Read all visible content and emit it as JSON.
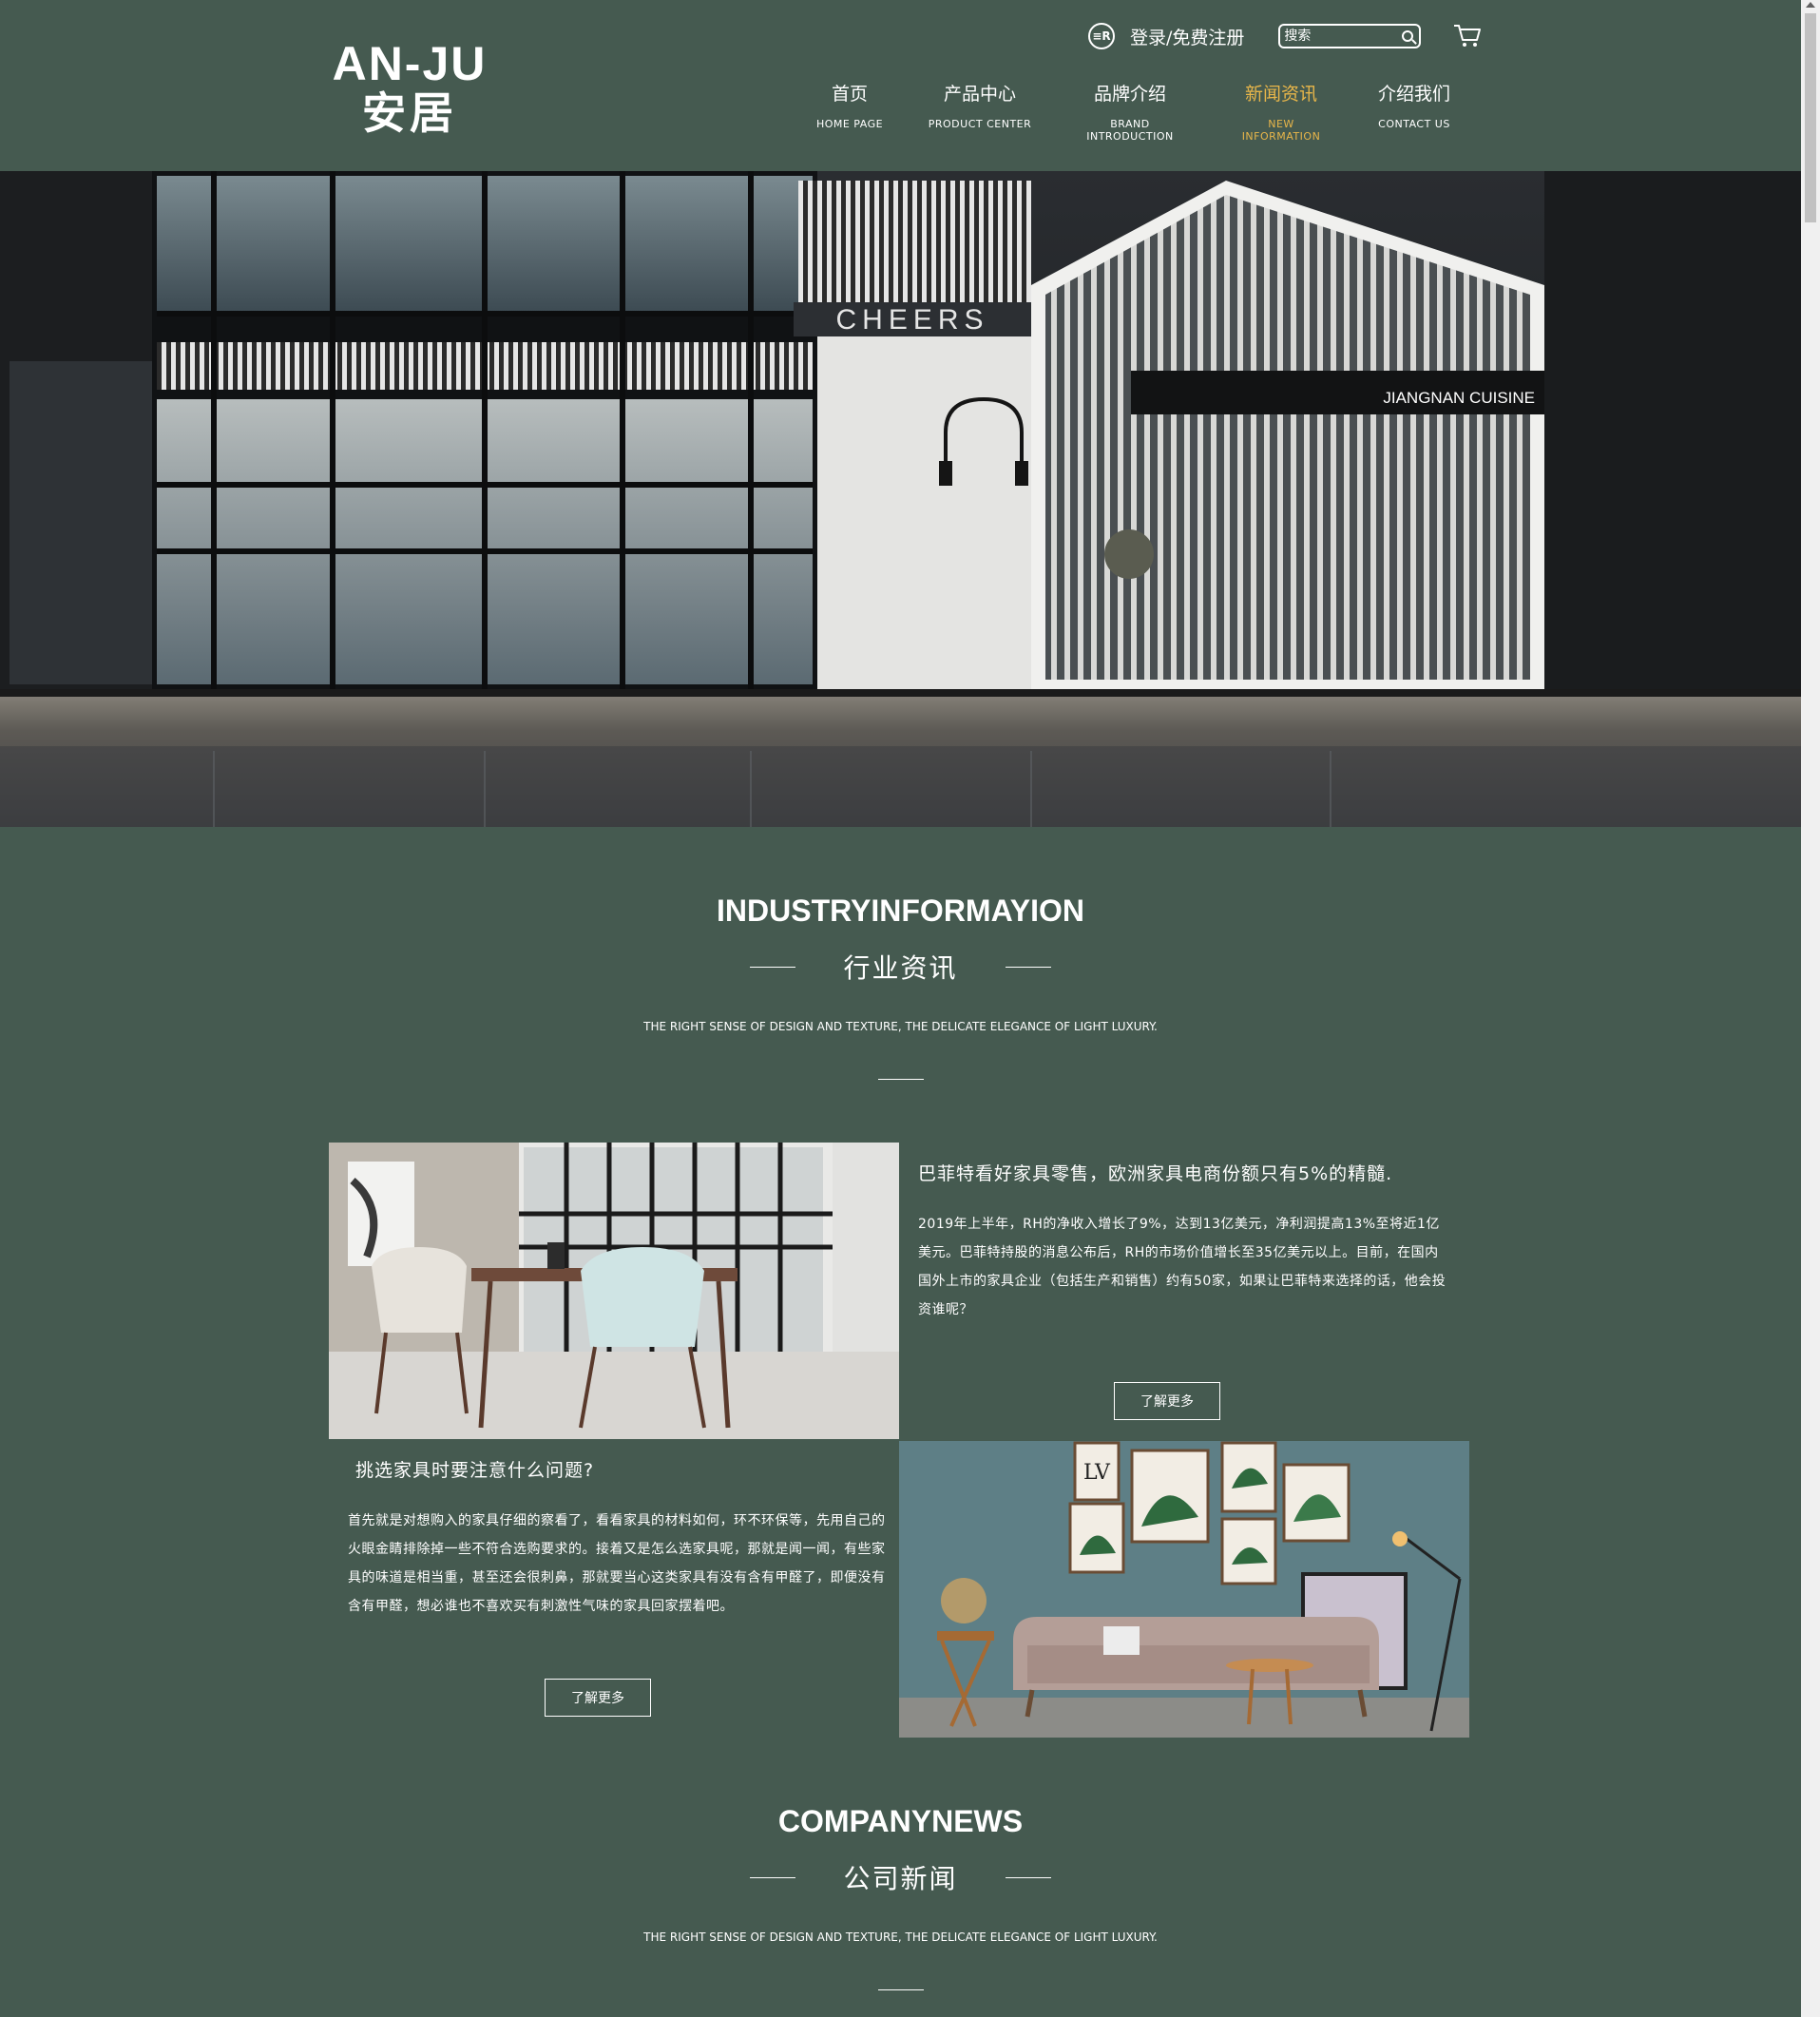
{
  "header": {
    "logo_en": "AN-JU",
    "logo_cn": "安居",
    "login_icon_text": "≡R",
    "login_text": "登录/免费注册",
    "search_placeholder": "搜索",
    "nav": [
      {
        "cn": "首页",
        "en": "HOME   PAGE",
        "active": false
      },
      {
        "cn": "产品中心",
        "en": "PRODUCT   CENTER",
        "active": false
      },
      {
        "cn": "品牌介绍",
        "en": "BRAND   INTRODUCTION",
        "active": false
      },
      {
        "cn": "新闻资讯",
        "en": "NEW   INFORMATION",
        "active": true
      },
      {
        "cn": "介绍我们",
        "en": "CONTACT   US",
        "active": false
      }
    ],
    "active_color": "#e8b64a"
  },
  "hero": {
    "sign_cheers": "CHEERS",
    "sign_jiangnan": "JIANGNAN CUISINE",
    "glass_sign": "CHEERS"
  },
  "industry": {
    "title_en": "INDUSTRYINFORMAYION",
    "title_cn": "行业资讯",
    "tagline": "THE RIGHT SENSE OF DESIGN AND TEXTURE, THE DELICATE ELEGANCE OF LIGHT LUXURY.",
    "article1": {
      "title": "巴菲特看好家具零售，欧洲家具电商份额只有5%的精髓.",
      "body": "2019年上半年，RH的净收入增长了9%，达到13亿美元，净利润提高13%至将近1亿美元。巴菲特持股的消息公布后，RH的市场价值增长至35亿美元以上。目前，在国内国外上市的家具企业（包括生产和销售）约有50家，如果让巴菲特来选择的话，他会投资谁呢？",
      "more": "了解更多"
    },
    "article2": {
      "title": "挑选家具时要注意什么问题?",
      "body": "首先就是对想购入的家具仔细的察看了，看看家具的材料如何，环不环保等，先用自己的火眼金睛排除掉一些不符合选购要求的。接着又是怎么选家具呢，那就是闻一闻，有些家具的味道是相当重，甚至还会很刺鼻，那就要当心这类家具有没有含有甲醛了，即便没有含有甲醛，想必谁也不喜欢买有刺激性气味的家具回家摆着吧。",
      "more": "了解更多"
    },
    "frame_lv_text": "LV"
  },
  "company": {
    "title_en": "COMPANYNEWS",
    "title_cn": "公司新闻",
    "tagline": "THE RIGHT SENSE OF DESIGN AND TEXTURE, THE DELICATE ELEGANCE OF LIGHT LUXURY."
  },
  "colors": {
    "background": "#455a50",
    "text": "#ffffff",
    "accent": "#e8b64a"
  }
}
